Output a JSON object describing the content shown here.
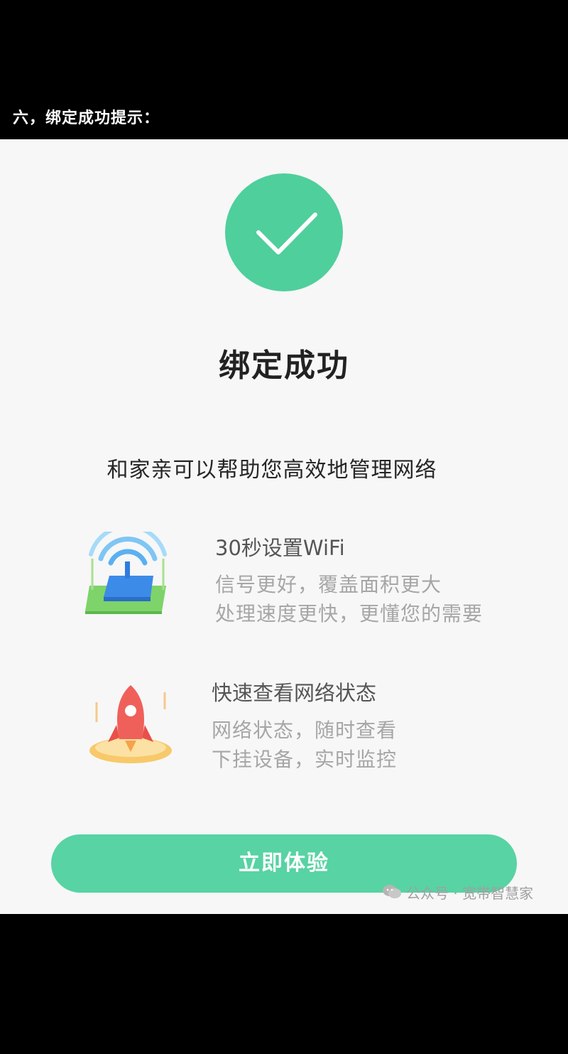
{
  "caption": "六，绑定成功提示：",
  "screen": {
    "title": "绑定成功",
    "subtitle": "和家亲可以帮助您高效地管理网络",
    "features": [
      {
        "icon": "router-wifi-icon",
        "title": "30秒设置WiFi",
        "line1": "信号更好，覆盖面积更大",
        "line2": "处理速度更快，更懂您的需要"
      },
      {
        "icon": "rocket-icon",
        "title": "快速查看网络状态",
        "line1": "网络状态，随时查看",
        "line2": "下挂设备，实时监控"
      }
    ],
    "cta_label": "立即体验",
    "watermark": "公众号 · 宽带智慧家"
  },
  "colors": {
    "accent_green": "#4fcf9c",
    "button_green": "#58d3a3",
    "background": "#f7f7f7"
  }
}
